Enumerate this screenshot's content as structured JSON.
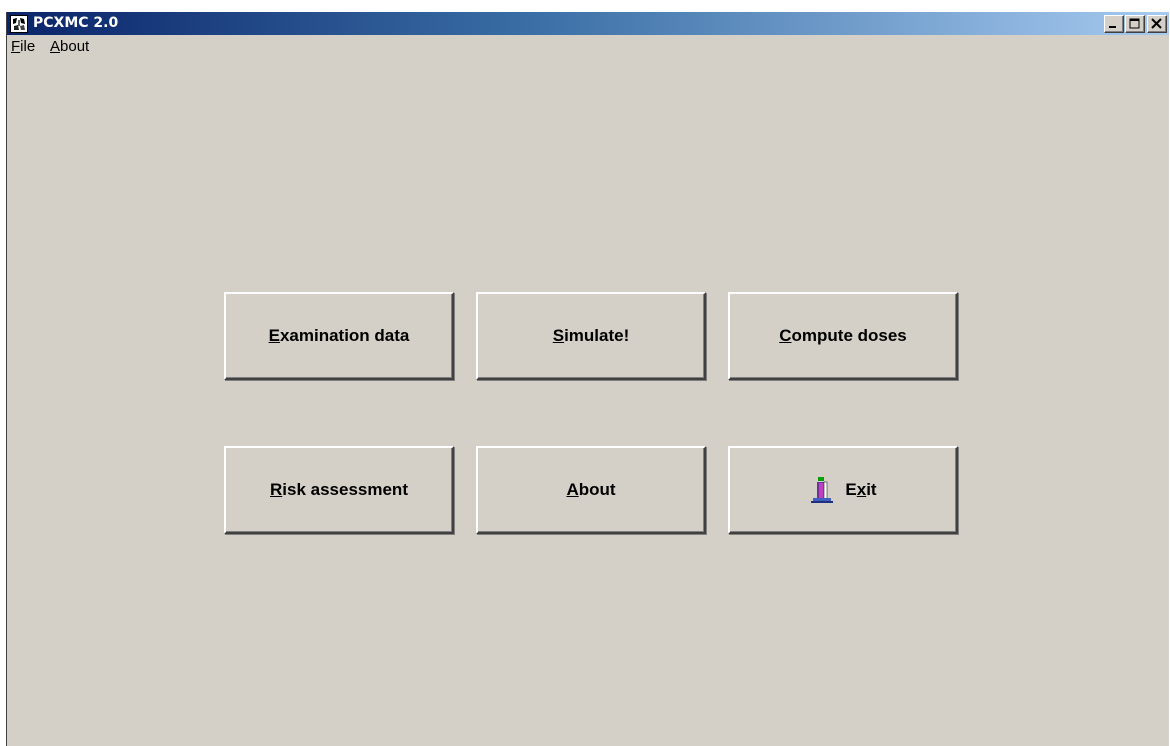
{
  "window": {
    "title": "PCXMC 2.0",
    "app_icon": "pcxmc-app-icon",
    "controls": {
      "minimize_icon": "minimize-icon",
      "maximize_icon": "maximize-icon",
      "close_icon": "close-icon"
    }
  },
  "menu": {
    "items": [
      {
        "label": "File",
        "mnemonic": "F"
      },
      {
        "label": "About",
        "mnemonic": "A"
      }
    ]
  },
  "buttons": {
    "examination": {
      "mnemonic": "E",
      "rest": "xamination data"
    },
    "simulate": {
      "mnemonic": "S",
      "rest": "imulate!"
    },
    "compute": {
      "mnemonic": "C",
      "rest": "ompute doses"
    },
    "risk": {
      "mnemonic": "R",
      "rest": "isk assessment"
    },
    "about": {
      "mnemonic": "A",
      "rest": "bout"
    },
    "exit": {
      "pre": "E",
      "mnemonic": "x",
      "rest": "it",
      "icon": "exit-door-icon"
    }
  },
  "colors": {
    "face": "#d4d0c8",
    "titlebar_start": "#0a246a",
    "titlebar_end": "#a6caf0",
    "title_text": "#ffffff"
  }
}
